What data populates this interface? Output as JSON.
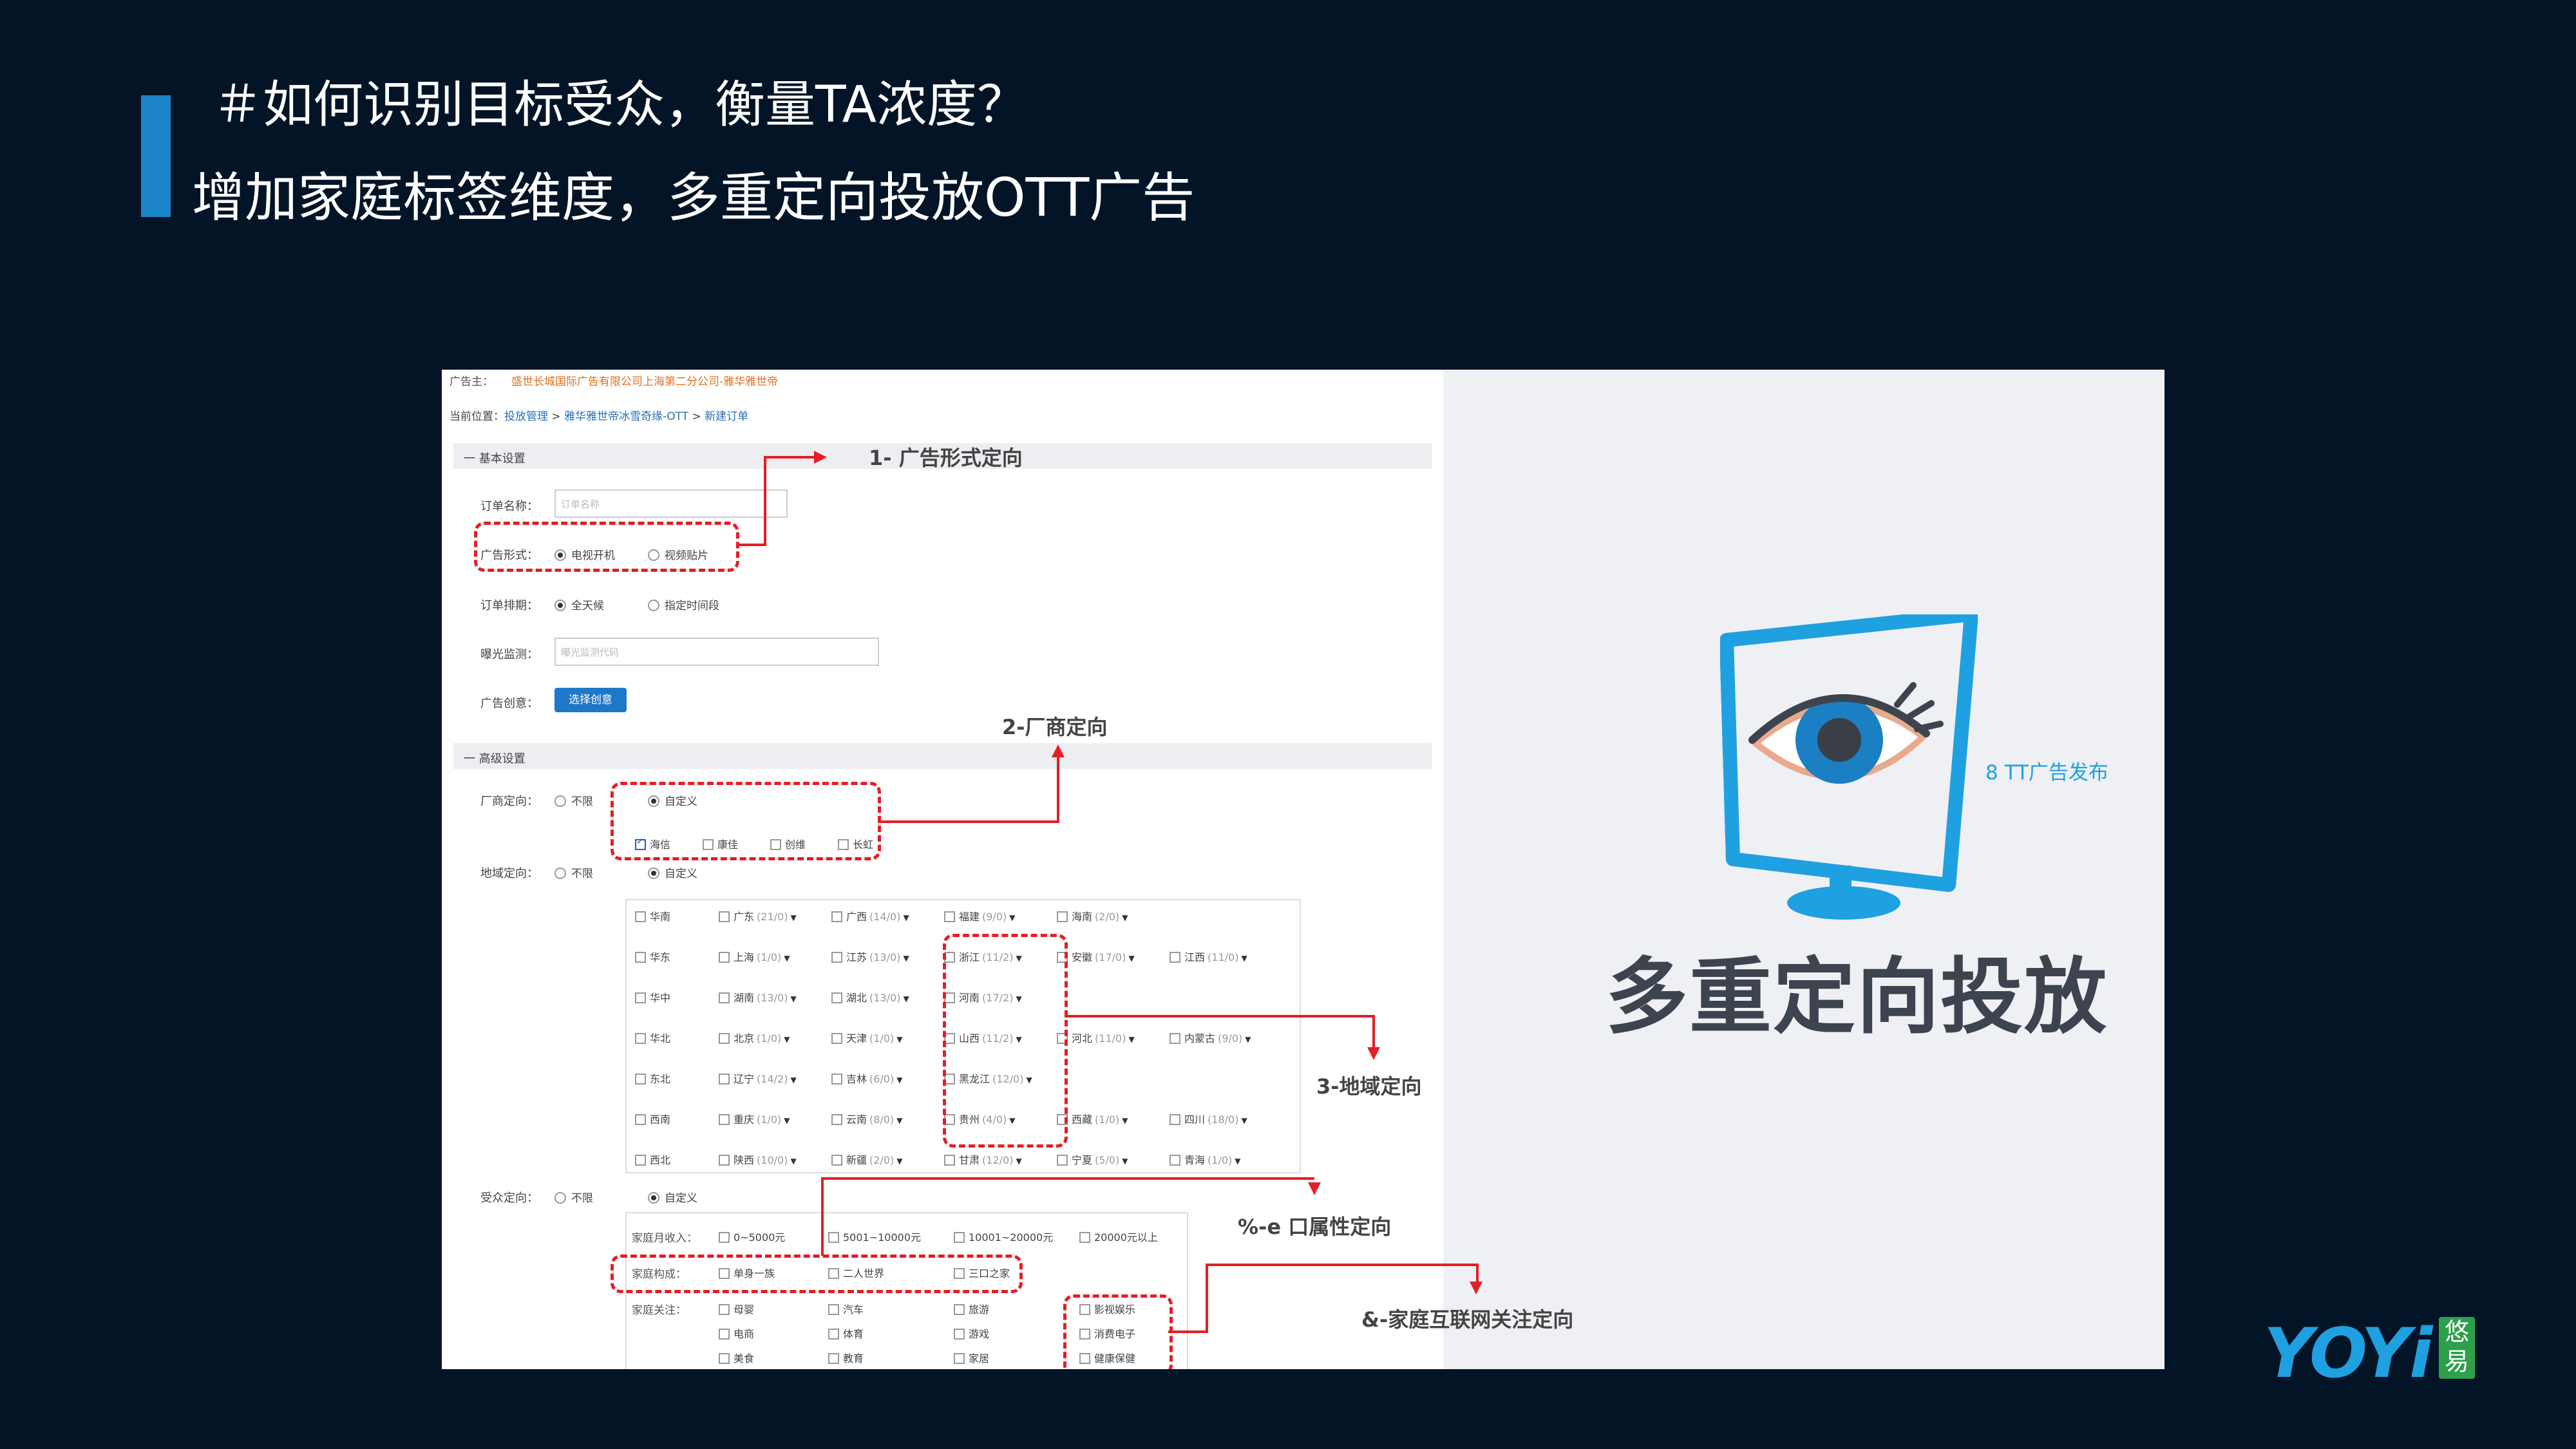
{
  "slide": {
    "title1": "＃如何识别目标受众，衡量TA浓度？",
    "title2": "增加家庭标签维度，多重定向投放OTT广告",
    "big_title": "多重定向投放",
    "ott_caption": "8 TT广告发布",
    "logo_text": "YOYi",
    "logo_badge": "悠易",
    "accent_color": "#1b85c9",
    "annotation_color": "#e41e26"
  },
  "form": {
    "advertiser_label": "广告主：",
    "advertiser_name": "盛世长城国际广告有限公司上海第二分公司-雅华雅世帝",
    "breadcrumb": {
      "prefix": "当前位置：",
      "items": [
        "投放管理",
        "雅华雅世帝冰雪奇缘-OTT",
        "新建订单"
      ],
      "sep": " > "
    },
    "section_basic": "一  基本设置",
    "section_advanced": "一  高级设置",
    "order_name_label": "订单名称：",
    "order_name_placeholder": "订单名称",
    "ad_format_label": "广告形式：",
    "ad_format_options": [
      "电视开机",
      "视频贴片"
    ],
    "schedule_label": "订单排期：",
    "schedule_options": [
      "全天候",
      "指定时间段"
    ],
    "exposure_label": "曝光监测：",
    "exposure_placeholder": "曝光监测代码",
    "creative_label": "广告创意：",
    "creative_button": "选择创意",
    "vendor_label": "厂商定向：",
    "vendor_options": [
      "不限",
      "自定义"
    ],
    "vendors": [
      "海信",
      "康佳",
      "创维",
      "长虹"
    ],
    "region_label": "地域定向：",
    "region_options": [
      "不限",
      "自定义"
    ],
    "regions": [
      {
        "area": "华南",
        "provinces": [
          {
            "n": "广东",
            "c": "(21/0)"
          },
          {
            "n": "广西",
            "c": "(14/0)"
          },
          {
            "n": "福建",
            "c": "(9/0)"
          },
          {
            "n": "海南",
            "c": "(2/0)"
          }
        ]
      },
      {
        "area": "华东",
        "provinces": [
          {
            "n": "上海",
            "c": "(1/0)"
          },
          {
            "n": "江苏",
            "c": "(13/0)"
          },
          {
            "n": "浙江",
            "c": "(11/2)"
          },
          {
            "n": "安徽",
            "c": "(17/0)"
          },
          {
            "n": "江西",
            "c": "(11/0)"
          }
        ]
      },
      {
        "area": "华中",
        "provinces": [
          {
            "n": "湖南",
            "c": "(13/0)"
          },
          {
            "n": "湖北",
            "c": "(13/0)"
          },
          {
            "n": "河南",
            "c": "(17/2)"
          }
        ]
      },
      {
        "area": "华北",
        "provinces": [
          {
            "n": "北京",
            "c": "(1/0)"
          },
          {
            "n": "天津",
            "c": "(1/0)"
          },
          {
            "n": "山西",
            "c": "(11/2)"
          },
          {
            "n": "河北",
            "c": "(11/0)"
          },
          {
            "n": "内蒙古",
            "c": "(9/0)"
          }
        ]
      },
      {
        "area": "东北",
        "provinces": [
          {
            "n": "辽宁",
            "c": "(14/2)"
          },
          {
            "n": "吉林",
            "c": "(6/0)"
          },
          {
            "n": "黑龙江",
            "c": "(12/0)"
          }
        ]
      },
      {
        "area": "西南",
        "provinces": [
          {
            "n": "重庆",
            "c": "(1/0)"
          },
          {
            "n": "云南",
            "c": "(8/0)"
          },
          {
            "n": "贵州",
            "c": "(4/0)"
          },
          {
            "n": "西藏",
            "c": "(1/0)"
          },
          {
            "n": "四川",
            "c": "(18/0)"
          }
        ]
      },
      {
        "area": "西北",
        "provinces": [
          {
            "n": "陕西",
            "c": "(10/0)"
          },
          {
            "n": "新疆",
            "c": "(2/0)"
          },
          {
            "n": "甘肃",
            "c": "(12/0)"
          },
          {
            "n": "宁夏",
            "c": "(5/0)"
          },
          {
            "n": "青海",
            "c": "(1/0)"
          }
        ]
      }
    ],
    "audience_label": "受众定向：",
    "audience_options": [
      "不限",
      "自定义"
    ],
    "income_label": "家庭月收入：",
    "income_options": [
      "0~5000元",
      "5001~10000元",
      "10001~20000元",
      "20000元以上"
    ],
    "structure_label": "家庭构成：",
    "structure_options": [
      "单身一族",
      "二人世界",
      "三口之家"
    ],
    "interest_label": "家庭关注：",
    "interests": [
      [
        "母婴",
        "汽车",
        "旅游",
        "影视娱乐"
      ],
      [
        "电商",
        "体育",
        "游戏",
        "消费电子"
      ],
      [
        "美食",
        "教育",
        "家居",
        "健康保健"
      ]
    ]
  },
  "annotations": {
    "a1": "1- 广告形式定向",
    "a2": "2-厂商定向",
    "a3": "3-地域定向",
    "a4": "%-e 口属性定向",
    "a5": "&-家庭互联网关注定向"
  }
}
